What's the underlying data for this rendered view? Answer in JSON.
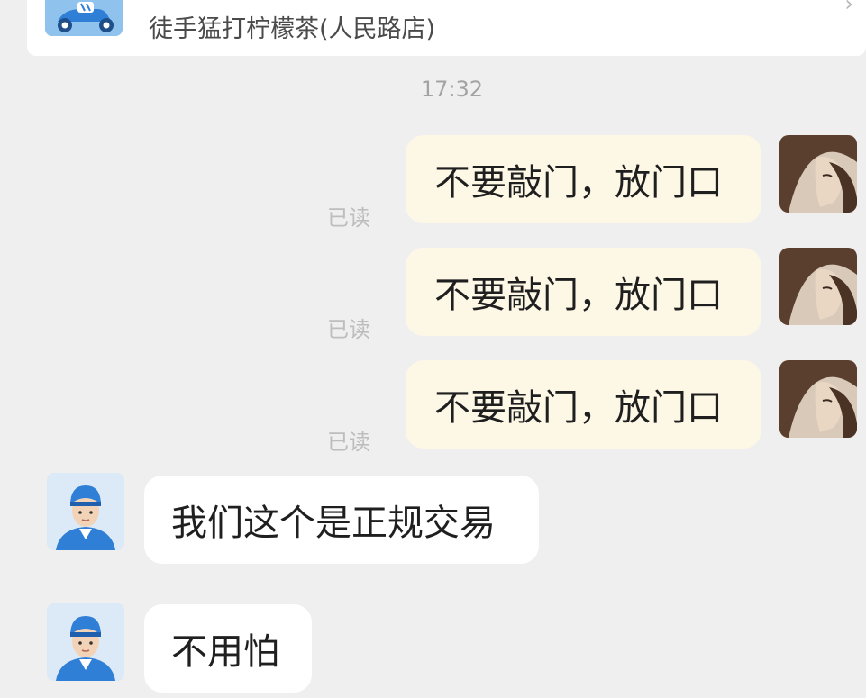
{
  "order": {
    "icon": "delivery-scooter-icon",
    "title": "徒手猛打柠檬茶(人民路店)",
    "arrow_icon": "chevron-right-icon"
  },
  "chat": {
    "timestamp": "17:32",
    "outgoing": [
      {
        "text": "不要敲门，放门口",
        "status": "已读"
      },
      {
        "text": "不要敲门，放门口",
        "status": "已读"
      },
      {
        "text": "不要敲门，放门口",
        "status": "已读"
      }
    ],
    "incoming": [
      {
        "text": "我们这个是正规交易"
      },
      {
        "text": "不用怕"
      }
    ]
  },
  "colors": {
    "background": "#efefef",
    "outgoing_bubble": "#fdf7e6",
    "incoming_bubble": "#ffffff",
    "courier_blue": "#2f7fd6"
  }
}
